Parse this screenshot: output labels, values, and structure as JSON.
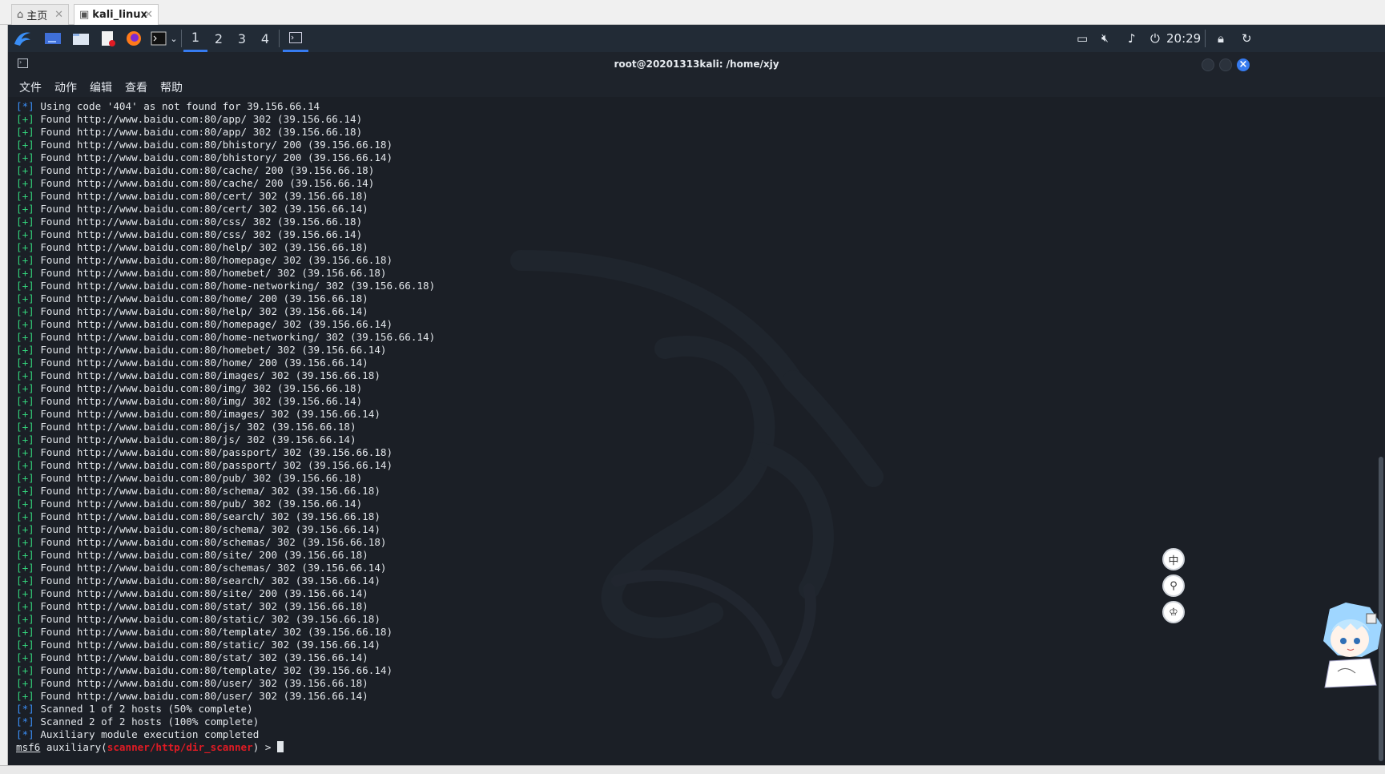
{
  "vm_tabs": [
    {
      "label": "主页",
      "icon": "home-icon",
      "active": false
    },
    {
      "label": "kali_linux",
      "icon": "vm-icon",
      "active": true
    }
  ],
  "panel": {
    "workspaces": [
      "1",
      "2",
      "3",
      "4"
    ],
    "active_workspace": "1",
    "clock": "20:29"
  },
  "terminal": {
    "title": "root@20201313kali: /home/xjy",
    "menu": [
      "文件",
      "动作",
      "编辑",
      "查看",
      "帮助"
    ],
    "lines": [
      {
        "tag": "[*]",
        "type": "star",
        "text": " Using code '404' as not found for 39.156.66.14"
      },
      {
        "tag": "[+]",
        "type": "plus",
        "text": " Found http://www.baidu.com:80/app/ 302 (39.156.66.14)"
      },
      {
        "tag": "[+]",
        "type": "plus",
        "text": " Found http://www.baidu.com:80/app/ 302 (39.156.66.18)"
      },
      {
        "tag": "[+]",
        "type": "plus",
        "text": " Found http://www.baidu.com:80/bhistory/ 200 (39.156.66.18)"
      },
      {
        "tag": "[+]",
        "type": "plus",
        "text": " Found http://www.baidu.com:80/bhistory/ 200 (39.156.66.14)"
      },
      {
        "tag": "[+]",
        "type": "plus",
        "text": " Found http://www.baidu.com:80/cache/ 200 (39.156.66.18)"
      },
      {
        "tag": "[+]",
        "type": "plus",
        "text": " Found http://www.baidu.com:80/cache/ 200 (39.156.66.14)"
      },
      {
        "tag": "[+]",
        "type": "plus",
        "text": " Found http://www.baidu.com:80/cert/ 302 (39.156.66.18)"
      },
      {
        "tag": "[+]",
        "type": "plus",
        "text": " Found http://www.baidu.com:80/cert/ 302 (39.156.66.14)"
      },
      {
        "tag": "[+]",
        "type": "plus",
        "text": " Found http://www.baidu.com:80/css/ 302 (39.156.66.18)"
      },
      {
        "tag": "[+]",
        "type": "plus",
        "text": " Found http://www.baidu.com:80/css/ 302 (39.156.66.14)"
      },
      {
        "tag": "[+]",
        "type": "plus",
        "text": " Found http://www.baidu.com:80/help/ 302 (39.156.66.18)"
      },
      {
        "tag": "[+]",
        "type": "plus",
        "text": " Found http://www.baidu.com:80/homepage/ 302 (39.156.66.18)"
      },
      {
        "tag": "[+]",
        "type": "plus",
        "text": " Found http://www.baidu.com:80/homebet/ 302 (39.156.66.18)"
      },
      {
        "tag": "[+]",
        "type": "plus",
        "text": " Found http://www.baidu.com:80/home-networking/ 302 (39.156.66.18)"
      },
      {
        "tag": "[+]",
        "type": "plus",
        "text": " Found http://www.baidu.com:80/home/ 200 (39.156.66.18)"
      },
      {
        "tag": "[+]",
        "type": "plus",
        "text": " Found http://www.baidu.com:80/help/ 302 (39.156.66.14)"
      },
      {
        "tag": "[+]",
        "type": "plus",
        "text": " Found http://www.baidu.com:80/homepage/ 302 (39.156.66.14)"
      },
      {
        "tag": "[+]",
        "type": "plus",
        "text": " Found http://www.baidu.com:80/home-networking/ 302 (39.156.66.14)"
      },
      {
        "tag": "[+]",
        "type": "plus",
        "text": " Found http://www.baidu.com:80/homebet/ 302 (39.156.66.14)"
      },
      {
        "tag": "[+]",
        "type": "plus",
        "text": " Found http://www.baidu.com:80/home/ 200 (39.156.66.14)"
      },
      {
        "tag": "[+]",
        "type": "plus",
        "text": " Found http://www.baidu.com:80/images/ 302 (39.156.66.18)"
      },
      {
        "tag": "[+]",
        "type": "plus",
        "text": " Found http://www.baidu.com:80/img/ 302 (39.156.66.18)"
      },
      {
        "tag": "[+]",
        "type": "plus",
        "text": " Found http://www.baidu.com:80/img/ 302 (39.156.66.14)"
      },
      {
        "tag": "[+]",
        "type": "plus",
        "text": " Found http://www.baidu.com:80/images/ 302 (39.156.66.14)"
      },
      {
        "tag": "[+]",
        "type": "plus",
        "text": " Found http://www.baidu.com:80/js/ 302 (39.156.66.18)"
      },
      {
        "tag": "[+]",
        "type": "plus",
        "text": " Found http://www.baidu.com:80/js/ 302 (39.156.66.14)"
      },
      {
        "tag": "[+]",
        "type": "plus",
        "text": " Found http://www.baidu.com:80/passport/ 302 (39.156.66.18)"
      },
      {
        "tag": "[+]",
        "type": "plus",
        "text": " Found http://www.baidu.com:80/passport/ 302 (39.156.66.14)"
      },
      {
        "tag": "[+]",
        "type": "plus",
        "text": " Found http://www.baidu.com:80/pub/ 302 (39.156.66.18)"
      },
      {
        "tag": "[+]",
        "type": "plus",
        "text": " Found http://www.baidu.com:80/schema/ 302 (39.156.66.18)"
      },
      {
        "tag": "[+]",
        "type": "plus",
        "text": " Found http://www.baidu.com:80/pub/ 302 (39.156.66.14)"
      },
      {
        "tag": "[+]",
        "type": "plus",
        "text": " Found http://www.baidu.com:80/search/ 302 (39.156.66.18)"
      },
      {
        "tag": "[+]",
        "type": "plus",
        "text": " Found http://www.baidu.com:80/schema/ 302 (39.156.66.14)"
      },
      {
        "tag": "[+]",
        "type": "plus",
        "text": " Found http://www.baidu.com:80/schemas/ 302 (39.156.66.18)"
      },
      {
        "tag": "[+]",
        "type": "plus",
        "text": " Found http://www.baidu.com:80/site/ 200 (39.156.66.18)"
      },
      {
        "tag": "[+]",
        "type": "plus",
        "text": " Found http://www.baidu.com:80/schemas/ 302 (39.156.66.14)"
      },
      {
        "tag": "[+]",
        "type": "plus",
        "text": " Found http://www.baidu.com:80/search/ 302 (39.156.66.14)"
      },
      {
        "tag": "[+]",
        "type": "plus",
        "text": " Found http://www.baidu.com:80/site/ 200 (39.156.66.14)"
      },
      {
        "tag": "[+]",
        "type": "plus",
        "text": " Found http://www.baidu.com:80/stat/ 302 (39.156.66.18)"
      },
      {
        "tag": "[+]",
        "type": "plus",
        "text": " Found http://www.baidu.com:80/static/ 302 (39.156.66.18)"
      },
      {
        "tag": "[+]",
        "type": "plus",
        "text": " Found http://www.baidu.com:80/template/ 302 (39.156.66.18)"
      },
      {
        "tag": "[+]",
        "type": "plus",
        "text": " Found http://www.baidu.com:80/static/ 302 (39.156.66.14)"
      },
      {
        "tag": "[+]",
        "type": "plus",
        "text": " Found http://www.baidu.com:80/stat/ 302 (39.156.66.14)"
      },
      {
        "tag": "[+]",
        "type": "plus",
        "text": " Found http://www.baidu.com:80/template/ 302 (39.156.66.14)"
      },
      {
        "tag": "[+]",
        "type": "plus",
        "text": " Found http://www.baidu.com:80/user/ 302 (39.156.66.18)"
      },
      {
        "tag": "[+]",
        "type": "plus",
        "text": " Found http://www.baidu.com:80/user/ 302 (39.156.66.14)"
      },
      {
        "tag": "[*]",
        "type": "star",
        "text": " Scanned 1 of 2 hosts (50% complete)"
      },
      {
        "tag": "[*]",
        "type": "star",
        "text": " Scanned 2 of 2 hosts (100% complete)"
      },
      {
        "tag": "[*]",
        "type": "star",
        "text": " Auxiliary module execution completed"
      }
    ],
    "prompt": {
      "msf": "msf6",
      "prefix": " auxiliary(",
      "module": "scanner/http/dir_scanner",
      "suffix": ") > "
    }
  },
  "widget": {
    "buttons": [
      {
        "label": "中",
        "icon": "language-icon"
      },
      {
        "label": "⚲",
        "icon": "palette-icon"
      },
      {
        "label": "♔",
        "icon": "outfit-icon"
      }
    ]
  },
  "colors": {
    "accent": "#367bf0",
    "plus": "#33d17a",
    "star": "#3a8ef6",
    "module": "#e01b24"
  }
}
